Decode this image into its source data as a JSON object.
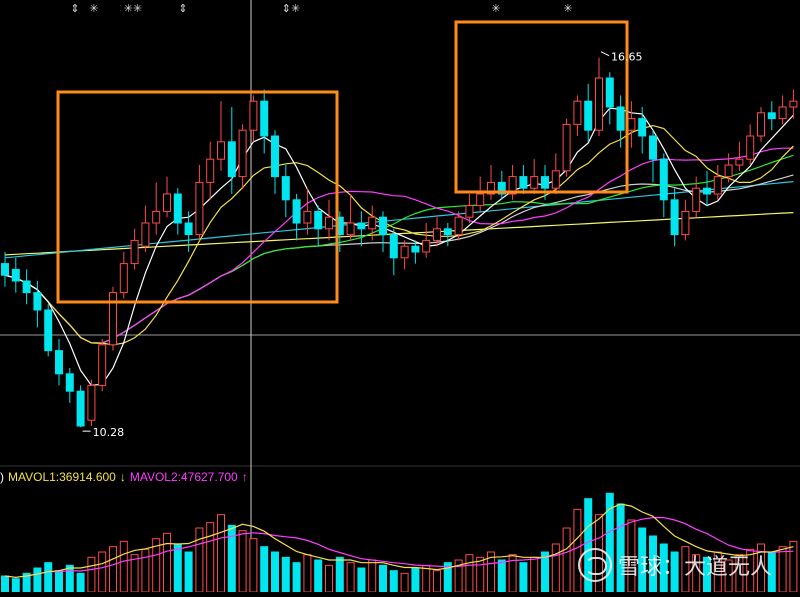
{
  "chart_data": {
    "type": "candlestick",
    "colors": {
      "up": "#ff4a4a",
      "down": "#00e5ee",
      "ma5": "#ffffff",
      "ma10": "#f4e04d",
      "ma20": "#ff3dff",
      "ma30": "#2ee82e",
      "ma60": "#cfcfcf",
      "ma120": "#29c7e0",
      "ma250": "#f5f56a",
      "highlight_box": "#ff8c1a",
      "crosshair": "#d0d0d0"
    },
    "price_range": [
      9.8,
      17.3
    ],
    "labels": {
      "low": "10.28",
      "high": "16.65"
    },
    "markers": [
      "⇕",
      "✳",
      "✳✳",
      "⇕",
      "⇕✳",
      "✳",
      "✳"
    ],
    "candles": [
      [
        13.1,
        12.9,
        13.3,
        12.7
      ],
      [
        13.0,
        12.8,
        13.2,
        12.6
      ],
      [
        12.8,
        12.6,
        13.0,
        12.4
      ],
      [
        12.6,
        12.3,
        12.8,
        12.0
      ],
      [
        12.3,
        11.6,
        12.4,
        11.5
      ],
      [
        11.6,
        11.2,
        11.8,
        11.0
      ],
      [
        11.2,
        10.9,
        11.3,
        10.7
      ],
      [
        10.9,
        10.3,
        11.0,
        10.28
      ],
      [
        10.4,
        11.0,
        11.1,
        10.3
      ],
      [
        11.0,
        11.7,
        11.8,
        10.9
      ],
      [
        11.7,
        12.6,
        12.7,
        11.6
      ],
      [
        12.6,
        13.1,
        13.3,
        12.5
      ],
      [
        13.1,
        13.5,
        13.7,
        13.0
      ],
      [
        13.4,
        13.8,
        14.1,
        13.3
      ],
      [
        13.8,
        14.0,
        14.5,
        13.6
      ],
      [
        14.0,
        14.3,
        14.6,
        13.9
      ],
      [
        14.3,
        13.8,
        14.4,
        13.6
      ],
      [
        13.8,
        13.6,
        14.0,
        13.3
      ],
      [
        13.6,
        14.5,
        14.8,
        13.5
      ],
      [
        14.5,
        14.9,
        15.2,
        14.2
      ],
      [
        14.9,
        15.2,
        15.9,
        14.7
      ],
      [
        15.2,
        14.6,
        15.8,
        14.3
      ],
      [
        14.6,
        15.4,
        15.5,
        14.4
      ],
      [
        15.4,
        15.9,
        16.0,
        15.2
      ],
      [
        15.9,
        15.3,
        16.1,
        15.0
      ],
      [
        15.3,
        14.6,
        15.4,
        14.3
      ],
      [
        14.6,
        14.2,
        14.8,
        13.9
      ],
      [
        14.2,
        13.8,
        14.3,
        13.5
      ],
      [
        13.8,
        14.0,
        14.4,
        13.6
      ],
      [
        14.0,
        13.7,
        14.1,
        13.4
      ],
      [
        13.7,
        13.9,
        14.2,
        13.5
      ],
      [
        13.9,
        13.6,
        14.0,
        13.3
      ],
      [
        13.6,
        13.8,
        14.3,
        13.5
      ],
      [
        13.8,
        13.7,
        14.0,
        13.4
      ],
      [
        13.7,
        13.9,
        14.1,
        13.5
      ],
      [
        13.9,
        13.6,
        14.0,
        13.3
      ],
      [
        13.6,
        13.2,
        13.7,
        12.9
      ],
      [
        13.2,
        13.4,
        13.5,
        13.0
      ],
      [
        13.4,
        13.3,
        13.5,
        13.1
      ],
      [
        13.3,
        13.5,
        13.8,
        13.2
      ],
      [
        13.5,
        13.7,
        13.9,
        13.4
      ],
      [
        13.7,
        13.6,
        13.8,
        13.4
      ],
      [
        13.6,
        13.9,
        14.0,
        13.5
      ],
      [
        13.9,
        14.1,
        14.3,
        13.8
      ],
      [
        14.1,
        14.3,
        14.6,
        14.0
      ],
      [
        14.3,
        14.5,
        14.8,
        14.2
      ],
      [
        14.5,
        14.3,
        14.7,
        14.2
      ],
      [
        14.3,
        14.6,
        14.8,
        14.2
      ],
      [
        14.6,
        14.4,
        14.8,
        14.3
      ],
      [
        14.4,
        14.6,
        14.9,
        14.3
      ],
      [
        14.6,
        14.4,
        14.8,
        14.2
      ],
      [
        14.4,
        14.7,
        15.0,
        14.3
      ],
      [
        14.7,
        15.5,
        15.6,
        14.6
      ],
      [
        15.5,
        15.9,
        16.0,
        15.3
      ],
      [
        15.9,
        15.4,
        16.2,
        15.2
      ],
      [
        15.4,
        16.3,
        16.65,
        15.3
      ],
      [
        16.3,
        15.8,
        16.4,
        15.5
      ],
      [
        15.8,
        15.4,
        16.0,
        15.1
      ],
      [
        15.4,
        15.6,
        15.9,
        15.1
      ],
      [
        15.6,
        15.3,
        15.8,
        15.0
      ],
      [
        15.3,
        14.9,
        15.4,
        14.5
      ],
      [
        14.9,
        14.2,
        15.0,
        13.9
      ],
      [
        14.2,
        13.6,
        14.4,
        13.4
      ],
      [
        13.6,
        14.0,
        14.2,
        13.5
      ],
      [
        14.0,
        14.4,
        14.6,
        13.9
      ],
      [
        14.4,
        14.3,
        14.7,
        14.1
      ],
      [
        14.3,
        14.6,
        14.8,
        14.2
      ],
      [
        14.6,
        14.8,
        15.0,
        14.5
      ],
      [
        14.8,
        14.9,
        15.2,
        14.7
      ],
      [
        14.9,
        15.3,
        15.5,
        14.8
      ],
      [
        15.3,
        15.7,
        15.8,
        15.2
      ],
      [
        15.7,
        15.6,
        15.9,
        15.4
      ],
      [
        15.6,
        15.8,
        16.0,
        15.5
      ],
      [
        15.8,
        15.9,
        16.1,
        15.6
      ]
    ],
    "volumes": [
      12,
      10,
      14,
      18,
      22,
      16,
      20,
      14,
      26,
      30,
      34,
      38,
      28,
      32,
      40,
      44,
      36,
      30,
      48,
      52,
      58,
      50,
      46,
      40,
      34,
      30,
      26,
      22,
      28,
      24,
      20,
      26,
      22,
      18,
      24,
      20,
      16,
      14,
      18,
      20,
      16,
      22,
      24,
      28,
      26,
      30,
      24,
      28,
      22,
      26,
      30,
      36,
      48,
      62,
      70,
      58,
      74,
      66,
      54,
      48,
      42,
      36,
      30,
      34,
      28,
      26,
      30,
      24,
      28,
      32,
      36,
      30,
      34,
      38
    ],
    "legend": {
      "left_fragment": ")",
      "mavol1": "MAVOL1:36914.600",
      "mavol1_arrow": "↓",
      "mavol2": "MAVOL2:47627.700",
      "mavol2_arrow": "↑"
    }
  },
  "watermark": {
    "text": "雪球：大道无人"
  }
}
